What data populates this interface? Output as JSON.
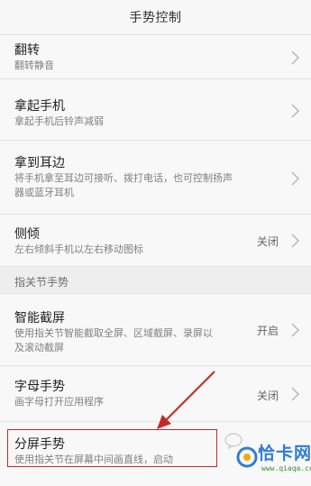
{
  "header": {
    "title": "手势控制"
  },
  "items_top": [
    {
      "title": "翻转",
      "sub": [
        "翻转静音"
      ],
      "value": ""
    },
    {
      "title": "拿起手机",
      "sub": [
        "拿起手机后铃声减弱"
      ],
      "value": ""
    },
    {
      "title": "拿到耳边",
      "sub": [
        "将手机拿至耳边可接听、拨打电话，也可控制扬声",
        "器或蓝牙耳机"
      ],
      "value": ""
    },
    {
      "title": "侧倾",
      "sub": [
        "左右倾斜手机以左右移动图标"
      ],
      "value": "关闭"
    }
  ],
  "section": {
    "label": "指关节手势"
  },
  "items_bottom": [
    {
      "title": "智能截屏",
      "sub": [
        "使用指关节智能截取全屏、区域截屏、录屏以",
        "及滚动截屏"
      ],
      "value": "开启"
    },
    {
      "title": "字母手势",
      "sub": [
        "画字母打开应用程序"
      ],
      "value": "关闭"
    },
    {
      "title": "分屏手势",
      "sub": [
        "使用指关节在屏幕中间画直线，启动"
      ],
      "value": ""
    }
  ],
  "watermark": {
    "brand": "恰卡网",
    "url": "www.qiaqa.com"
  },
  "colors": {
    "highlight": "#c62828",
    "watermark_blue": "#2e7dd6",
    "watermark_green": "#3a8a3a"
  }
}
